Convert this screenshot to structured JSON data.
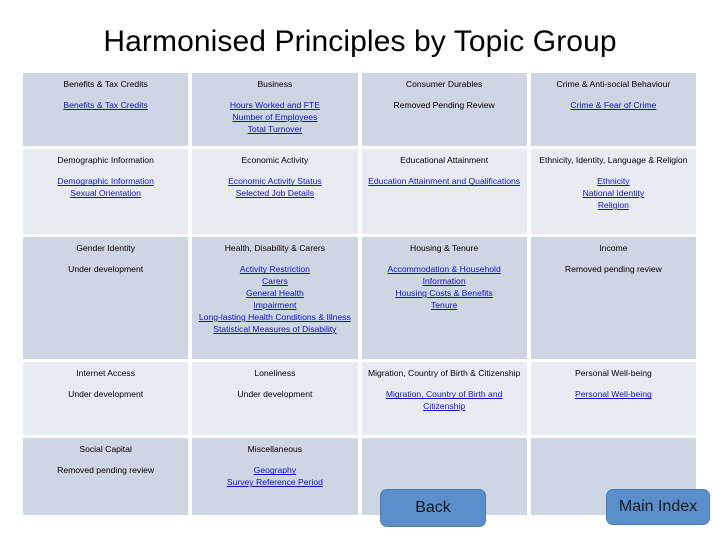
{
  "title": "Harmonised Principles by Topic Group",
  "colors": {
    "row_dark": "#ced5e3",
    "row_light": "#e8ebf2",
    "link": "#1111cc",
    "button_fill": "#5b8fcc",
    "text": "#000000"
  },
  "grid": {
    "rows": [
      {
        "shade": "dark",
        "cells": [
          {
            "heading": "Benefits & Tax Credits",
            "links": [
              "Benefits & Tax Credits"
            ],
            "note": ""
          },
          {
            "heading": "Business",
            "links": [
              "Hours Worked and FTE",
              "Number of Employees",
              "Total Turnover"
            ],
            "note": ""
          },
          {
            "heading": "Consumer Durables",
            "links": [],
            "note": "Removed Pending Review"
          },
          {
            "heading": "Crime & Anti-social Behaviour",
            "links": [
              "Crime & Fear of Crime"
            ],
            "note": ""
          }
        ]
      },
      {
        "shade": "light",
        "cells": [
          {
            "heading": "Demographic Information",
            "links": [
              "Demographic Information",
              "Sexual Orientation"
            ],
            "note": ""
          },
          {
            "heading": "Economic Activity",
            "links": [
              "Economic Activity Status",
              "Selected Job Details"
            ],
            "note": ""
          },
          {
            "heading": "Educational Attainment",
            "links": [
              "Education Attainment and Qualifications"
            ],
            "note": ""
          },
          {
            "heading": "Ethnicity, Identity, Language & Religion",
            "links": [
              "Ethnicity",
              "National Identity",
              "Religion"
            ],
            "note": ""
          }
        ]
      },
      {
        "shade": "dark",
        "cells": [
          {
            "heading": "Gender Identity",
            "links": [],
            "note": "Under development"
          },
          {
            "heading": "Health, Disability & Carers",
            "links": [
              "Activity Restriction",
              "Carers",
              "General Health",
              "Impairment",
              "Long-lasting Health Conditions & Illness",
              "Statistical Measures of Disability"
            ],
            "note": ""
          },
          {
            "heading": "Housing & Tenure",
            "links": [
              "Accommodation & Household Information",
              "Housing Costs & Benefits",
              "Tenure"
            ],
            "note": ""
          },
          {
            "heading": "Income",
            "links": [],
            "note": "Removed pending review"
          }
        ]
      },
      {
        "shade": "light",
        "cells": [
          {
            "heading": "Internet Access",
            "links": [],
            "note": "Under development"
          },
          {
            "heading": "Loneliness",
            "links": [],
            "note": "Under development"
          },
          {
            "heading": "Migration, Country of Birth & Citizenship",
            "links": [
              "Migration, Country of Birth and Citizenship"
            ],
            "note": ""
          },
          {
            "heading": "Personal Well-being",
            "links": [
              "Personal Well-being"
            ],
            "note": ""
          }
        ]
      },
      {
        "shade": "dark",
        "cells": [
          {
            "heading": "Social Capital",
            "links": [],
            "note": "Removed pending review"
          },
          {
            "heading": "Miscellaneous",
            "links": [
              "Geography",
              "Survey Reference Period"
            ],
            "note": ""
          },
          {
            "heading": "",
            "links": [],
            "note": ""
          },
          {
            "heading": "",
            "links": [],
            "note": ""
          }
        ]
      }
    ]
  },
  "buttons": {
    "back": "Back",
    "main_index": "Main Index"
  }
}
